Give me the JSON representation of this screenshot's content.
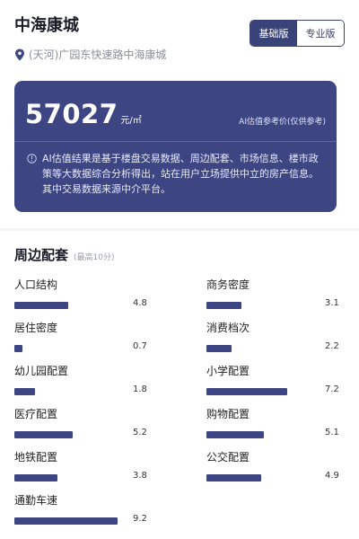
{
  "header": {
    "title": "中海康城",
    "address": "(天河)广园东快速路中海康城",
    "toggle": {
      "basic": "基础版",
      "pro": "专业版",
      "active": "basic"
    }
  },
  "valuation": {
    "price": "57027",
    "unit": "元/㎡",
    "ai_ref": "AI估值参考价(仅供参考)",
    "note": "AI估值结果是基于楼盘交易数据、周边配套、市场信息、楼市政策等大数据综合分析得出，站在用户立场提供中立的房产信息。其中交易数据来源中介平台。"
  },
  "facilities": {
    "title": "周边配套",
    "subtitle": "(最高10分)",
    "max": 10,
    "items": [
      {
        "label": "人口结构",
        "value": 4.8,
        "display": "4.8"
      },
      {
        "label": "商务密度",
        "value": 3.1,
        "display": "3.1"
      },
      {
        "label": "居住密度",
        "value": 0.7,
        "display": "0.7"
      },
      {
        "label": "消费档次",
        "value": 2.2,
        "display": "2.2"
      },
      {
        "label": "幼儿园配置",
        "value": 1.8,
        "display": "1.8"
      },
      {
        "label": "小学配置",
        "value": 7.2,
        "display": "7.2"
      },
      {
        "label": "医疗配置",
        "value": 5.2,
        "display": "5.2"
      },
      {
        "label": "购物配置",
        "value": 5.1,
        "display": "5.1"
      },
      {
        "label": "地铁配置",
        "value": 3.8,
        "display": "3.8"
      },
      {
        "label": "公交配置",
        "value": 4.9,
        "display": "4.9"
      },
      {
        "label": "通勤车速",
        "value": 9.2,
        "display": "9.2"
      }
    ]
  },
  "colors": {
    "accent": "#3d4683",
    "text": "#1a1d26",
    "muted": "#8a8f99"
  }
}
